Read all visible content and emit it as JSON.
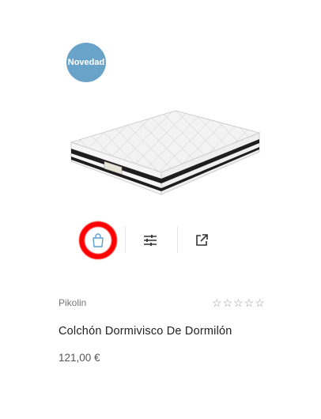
{
  "badge": {
    "label": "Novedad"
  },
  "product": {
    "brand": "Pikolin",
    "title": "Colchón Dormivisco De Dormilón",
    "price": "121,00 €",
    "rating": {
      "stars": 0,
      "max": 5
    }
  },
  "actions": {
    "items": [
      {
        "name": "add-to-cart",
        "icon": "shopping-bag-icon"
      },
      {
        "name": "compare",
        "icon": "sliders-icon"
      },
      {
        "name": "open-details",
        "icon": "external-link-icon"
      }
    ]
  },
  "colors": {
    "badge": "#6aa3c9",
    "cart_icon": "#5a9fd6",
    "annotation_ring": "#ff0000"
  }
}
